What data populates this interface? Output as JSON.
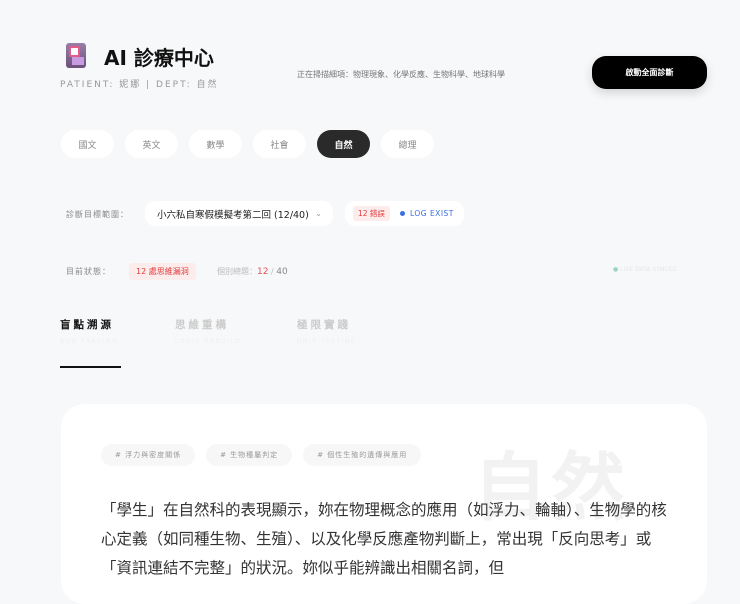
{
  "header": {
    "title": "AI 診療中心",
    "subtitle": "PATIENT: 妮娜 | DEPT: 自然",
    "scanning": "正在掃描細項：物理現象、化學反應、生物科學、地球科學",
    "launch_button": "啟動全面診斷"
  },
  "subjects": [
    {
      "label": "國文"
    },
    {
      "label": "英文"
    },
    {
      "label": "數學"
    },
    {
      "label": "社會"
    },
    {
      "label": "自然",
      "active": true
    },
    {
      "label": "總理"
    }
  ],
  "filter": {
    "label": "診斷目標範圍：",
    "selected": "小六私自寒假模擬考第二回 (12/40)",
    "error_badge": "12 錯誤",
    "log_status": "LOG EXIST"
  },
  "status": {
    "label": "目前狀態：",
    "badge": "12 處思維漏洞",
    "count_label": "個別總題：",
    "wrong": "12",
    "separator": "/",
    "total": "40",
    "sync": "LIVE DATA SYNCED"
  },
  "mode_tabs": [
    {
      "zh": "盲點溯源",
      "en": "BUG TRACING",
      "active": true
    },
    {
      "zh": "思維重構",
      "en": "LOGIC REBUILD"
    },
    {
      "zh": "極限實踐",
      "en": "UNIT TESTING"
    }
  ],
  "card": {
    "watermark": "自然",
    "tags": [
      "# 浮力與密度關係",
      "# 生物種屬判定",
      "# 個性生殖的遺傳與應用"
    ],
    "text": "「學生」在自然科的表現顯示，妳在物理概念的應用（如浮力、輪軸）、生物學的核心定義（如同種生物、生殖）、以及化學反應產物判斷上，常出現「反向思考」或「資訊連結不完整」的狀況。妳似乎能辨識出相關名詞，但"
  }
}
